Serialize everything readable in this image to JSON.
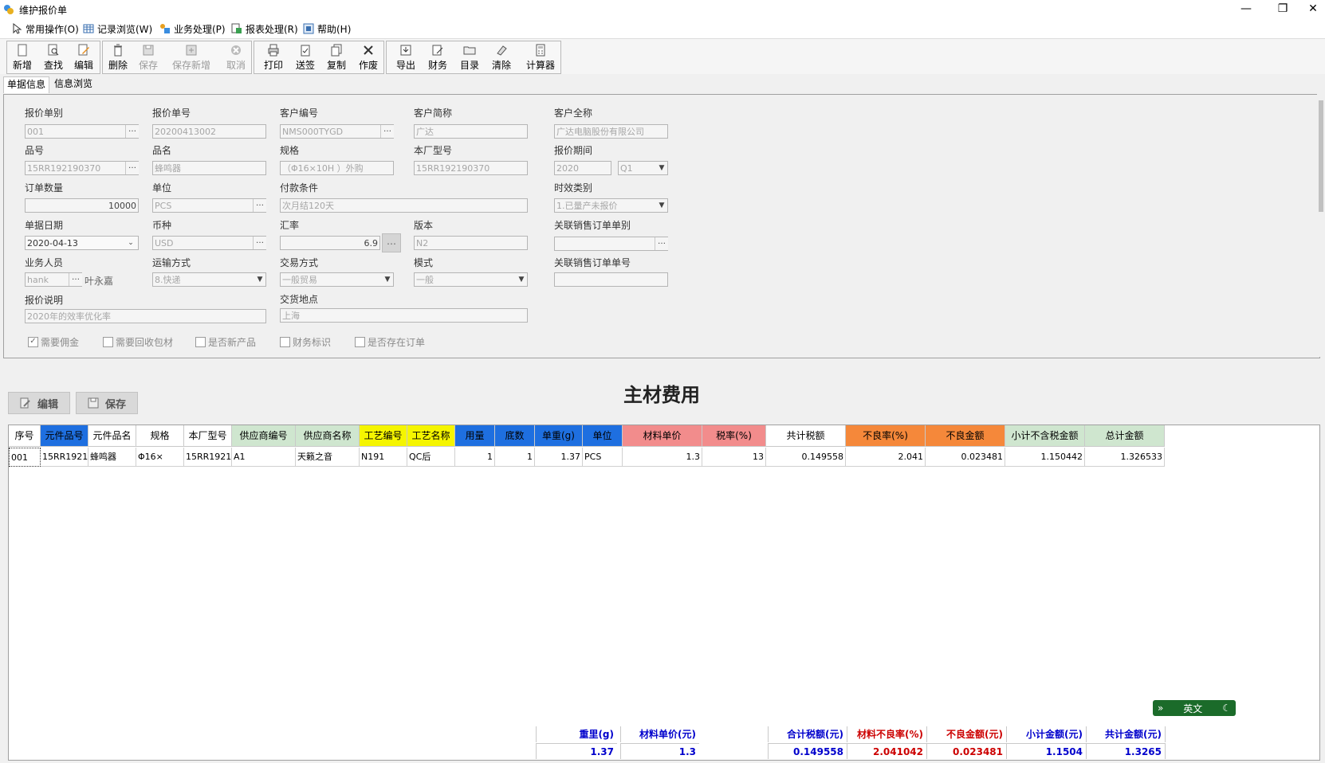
{
  "window": {
    "title": "维护报价单",
    "minimize": "—",
    "restore": "❐",
    "close": "✕"
  },
  "menu": [
    {
      "label": "常用操作(O)"
    },
    {
      "label": "记录浏览(W)"
    },
    {
      "label": "业务处理(P)"
    },
    {
      "label": "报表处理(R)"
    },
    {
      "label": "帮助(H)"
    }
  ],
  "toolbar": {
    "new": "新增",
    "find": "查找",
    "edit": "编辑",
    "delete": "删除",
    "save": "保存",
    "save_new": "保存新增",
    "cancel": "取消",
    "print": "打印",
    "submit": "送签",
    "copy": "复制",
    "void": "作废",
    "export": "导出",
    "finance": "财务",
    "catalog": "目录",
    "clear": "清除",
    "calculator": "计算器"
  },
  "tabs": [
    {
      "label": "单据信息"
    },
    {
      "label": "信息浏览"
    }
  ],
  "form": {
    "quote_type_label": "报价单别",
    "quote_type": "001",
    "quote_no_label": "报价单号",
    "quote_no": "20200413002",
    "customer_code_label": "客户编号",
    "customer_code": "NMS000TYGD",
    "customer_short_label": "客户简称",
    "customer_short": "广达",
    "customer_full_label": "客户全称",
    "customer_full": "广达电脑股份有限公司",
    "part_no_label": "品号",
    "part_no": "15RR192190370",
    "part_name_label": "品名",
    "part_name": "蜂鸣器",
    "spec_label": "规格",
    "spec": "（Φ16×10H ）外购",
    "factory_model_label": "本厂型号",
    "factory_model": "15RR192190370",
    "period_label": "报价期间",
    "period_year": "2020",
    "period_quarter": "Q1",
    "order_qty_label": "订单数量",
    "order_qty": "10000",
    "unit_label": "单位",
    "unit": "PCS",
    "payment_label": "付款条件",
    "payment": "次月结120天",
    "aging_label": "时效类别",
    "aging": "1.已量产未报价",
    "doc_date_label": "单据日期",
    "doc_date": "2020-04-13",
    "currency_label": "币种",
    "currency": "USD",
    "rate_label": "汇率",
    "rate": "6.9",
    "version_label": "版本",
    "version": "N2",
    "so_type_label": "关联销售订单单别",
    "so_type": "",
    "sales_label": "业务人员",
    "sales_code": "hank",
    "sales_name": "叶永嘉",
    "transport_label": "运输方式",
    "transport": "8.快递",
    "trade_label": "交易方式",
    "trade": "一般贸易",
    "mode_label": "模式",
    "mode": "一般",
    "so_no_label": "关联销售订单单号",
    "so_no": "",
    "remark_label": "报价说明",
    "remark": "2020年的效率优化率",
    "delivery_label": "交货地点",
    "delivery": "上海",
    "checks": {
      "commission": "需要佣金",
      "recycle": "需要回收包材",
      "new_product": "是否新产品",
      "finance_flag": "财务标识",
      "in_order": "是否存在订单"
    }
  },
  "section": {
    "edit_btn": "编辑",
    "save_btn": "保存",
    "title": "主材费用"
  },
  "grid": {
    "headers": [
      "序号",
      "元件品号",
      "元件品名",
      "规格",
      "本厂型号",
      "供应商编号",
      "供应商名称",
      "工艺编号",
      "工艺名称",
      "用量",
      "底数",
      "单重(g)",
      "单位",
      "材料单价",
      "税率(%)",
      "共计税额",
      "不良率(%)",
      "不良金额",
      "小计不含税金额",
      "总计金额"
    ],
    "rows": [
      [
        "001",
        "15RR1921",
        "蜂鸣器",
        "Φ16×",
        "15RR1921",
        "A1",
        "天籁之音",
        "N191",
        "QC后",
        "1",
        "1",
        "1.37",
        "PCS",
        "1.3",
        "13",
        "0.149558",
        "2.041",
        "0.023481",
        "1.150442",
        "1.326533"
      ]
    ]
  },
  "summary": {
    "weight_label": "重里(g)",
    "weight": "1.37",
    "unit_price_label": "材料单价(元)",
    "unit_price": "1.3",
    "tax_label": "合计税额(元)",
    "tax": "0.149558",
    "defect_rate_label": "材料不良率(%)",
    "defect_rate": "2.041042",
    "defect_amount_label": "不良金额(元)",
    "defect_amount": "0.023481",
    "subtotal_label": "小计金额(元)",
    "subtotal": "1.1504",
    "total_label": "共计金额(元)",
    "total": "1.3265"
  },
  "lang": {
    "label": "英文"
  },
  "colors": {
    "blue": "#1e6fe0",
    "yellow": "#f5f500",
    "green": "#cfe6cf",
    "salmon": "#f28c8c",
    "orange": "#f5883a",
    "summary_blue": "#0000cc",
    "summary_red": "#cc0000"
  }
}
